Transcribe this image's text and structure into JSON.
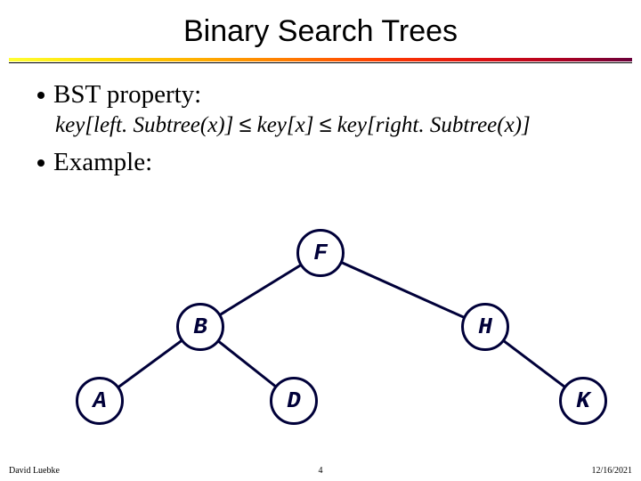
{
  "title": "Binary Search Trees",
  "bullets": {
    "b1": "BST property:",
    "b2": "Example:"
  },
  "property": {
    "left": "key[left. Subtree(x)]",
    "mid": "key[x]",
    "right": "key[right. Subtree(x)]",
    "le": "≤"
  },
  "tree": {
    "F": "F",
    "B": "B",
    "H": "H",
    "A": "A",
    "D": "D",
    "K": "K"
  },
  "footer": {
    "author": "David Luebke",
    "page": "4",
    "date": "12/16/2021"
  },
  "chart_data": {
    "type": "tree",
    "nodes": [
      "F",
      "B",
      "H",
      "A",
      "D",
      "K"
    ],
    "edges": [
      [
        "F",
        "B"
      ],
      [
        "F",
        "H"
      ],
      [
        "B",
        "A"
      ],
      [
        "B",
        "D"
      ],
      [
        "H",
        "K"
      ]
    ],
    "root": "F"
  }
}
